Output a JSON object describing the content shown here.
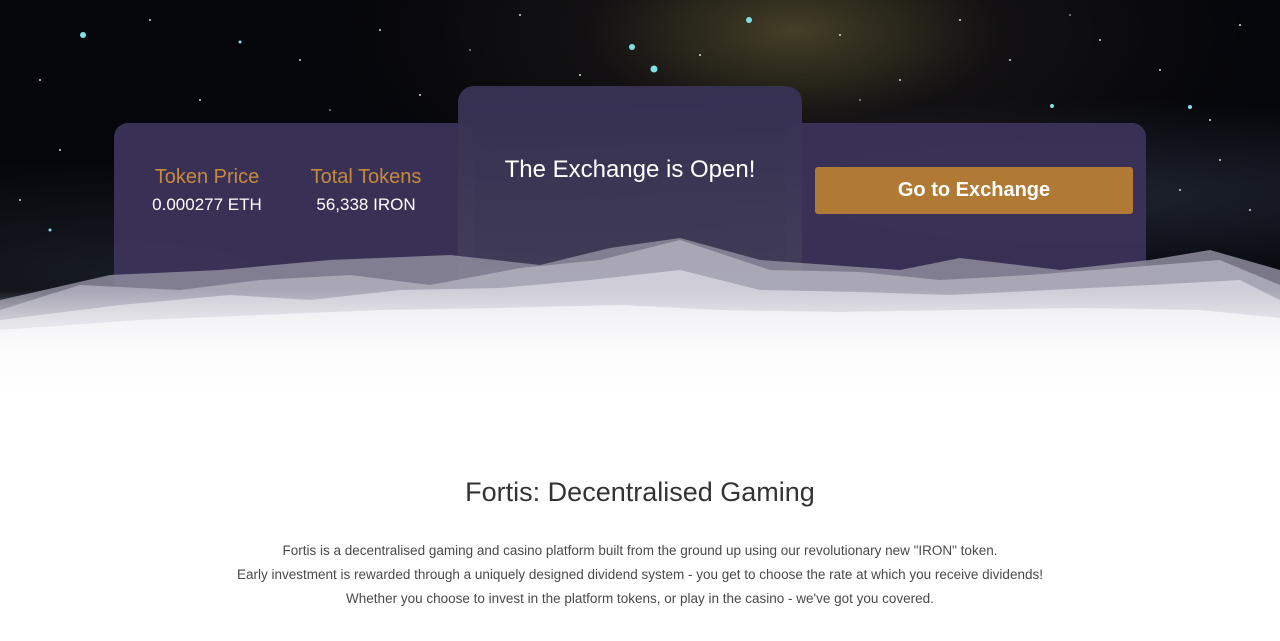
{
  "hero": {
    "stats": {
      "token_price_label": "Token Price",
      "token_price_value": "0.000277 ETH",
      "total_tokens_label": "Total Tokens",
      "total_tokens_value": "56,338 IRON"
    },
    "exchange_status": "The Exchange is Open!",
    "exchange_button_label": "Go to Exchange"
  },
  "content": {
    "title": "Fortis: Decentralised Gaming",
    "paragraph_lines": [
      "Fortis is a decentralised gaming and casino platform built from the ground up using our revolutionary new \"IRON\" token.",
      "Early investment is rewarded through a uniquely designed dividend system - you get to choose the rate at which you receive dividends!",
      "Whether you choose to invest in the platform tokens, or play in the casino - we've got you covered."
    ]
  },
  "colors": {
    "accent_gold": "#c8893c",
    "button_bg": "#b07a34",
    "panel_bg": "#3b3358",
    "space_bg": "#05060b"
  },
  "icons": []
}
